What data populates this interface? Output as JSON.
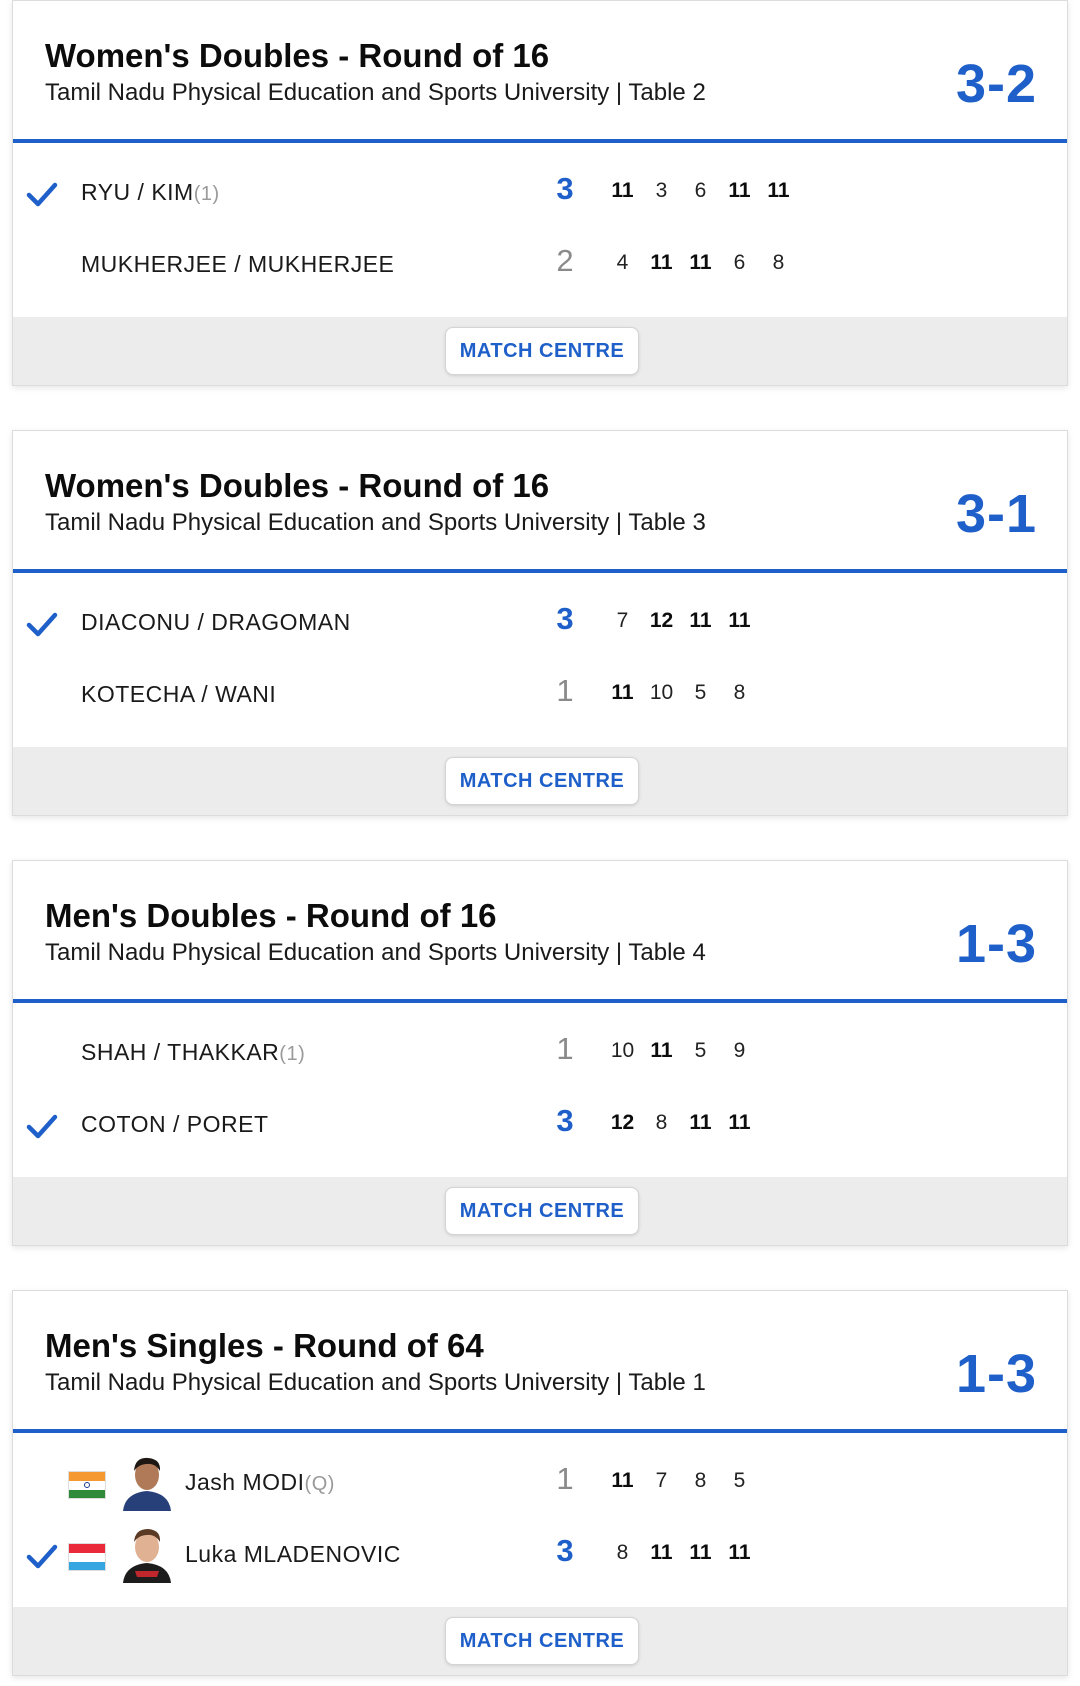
{
  "colors": {
    "accent": "#1f5fc9",
    "footer_bg": "#ececec"
  },
  "matches": [
    {
      "title": "Women's Doubles - Round of 16",
      "venue": "Tamil Nadu Physical Education and Sports University | Table 2",
      "score": "3-2",
      "players": [
        {
          "name": "RYU / KIM",
          "seed": "(1)",
          "winner": true,
          "sets": "3",
          "games": [
            "11",
            "3",
            "6",
            "11",
            "11"
          ]
        },
        {
          "name": "MUKHERJEE / MUKHERJEE",
          "seed": "",
          "winner": false,
          "sets": "2",
          "games": [
            "4",
            "11",
            "11",
            "6",
            "8"
          ]
        }
      ],
      "button": "MATCH CENTRE"
    },
    {
      "title": "Women's Doubles - Round of 16",
      "venue": "Tamil Nadu Physical Education and Sports University | Table 3",
      "score": "3-1",
      "players": [
        {
          "name": "DIACONU / DRAGOMAN",
          "seed": "",
          "winner": true,
          "sets": "3",
          "games": [
            "7",
            "12",
            "11",
            "11"
          ]
        },
        {
          "name": "KOTECHA / WANI",
          "seed": "",
          "winner": false,
          "sets": "1",
          "games": [
            "11",
            "10",
            "5",
            "8"
          ]
        }
      ],
      "button": "MATCH CENTRE"
    },
    {
      "title": "Men's Doubles - Round of 16",
      "venue": "Tamil Nadu Physical Education and Sports University | Table 4",
      "score": "1-3",
      "players": [
        {
          "name": "SHAH / THAKKAR",
          "seed": "(1)",
          "winner": false,
          "sets": "1",
          "games": [
            "10",
            "11",
            "5",
            "9"
          ]
        },
        {
          "name": "COTON / PORET",
          "seed": "",
          "winner": true,
          "sets": "3",
          "games": [
            "12",
            "8",
            "11",
            "11"
          ]
        }
      ],
      "button": "MATCH CENTRE"
    },
    {
      "title": "Men's Singles - Round of 64",
      "venue": "Tamil Nadu Physical Education and Sports University | Table 1",
      "score": "1-3",
      "players": [
        {
          "name": "Jash MODI",
          "seed": "(Q)",
          "winner": false,
          "sets": "1",
          "games": [
            "11",
            "7",
            "8",
            "5"
          ],
          "flag": "india-flag-icon"
        },
        {
          "name": "Luka MLADENOVIC",
          "seed": "",
          "winner": true,
          "sets": "3",
          "games": [
            "8",
            "11",
            "11",
            "11"
          ],
          "flag": "luxembourg-flag-icon"
        }
      ],
      "button": "MATCH CENTRE"
    }
  ]
}
